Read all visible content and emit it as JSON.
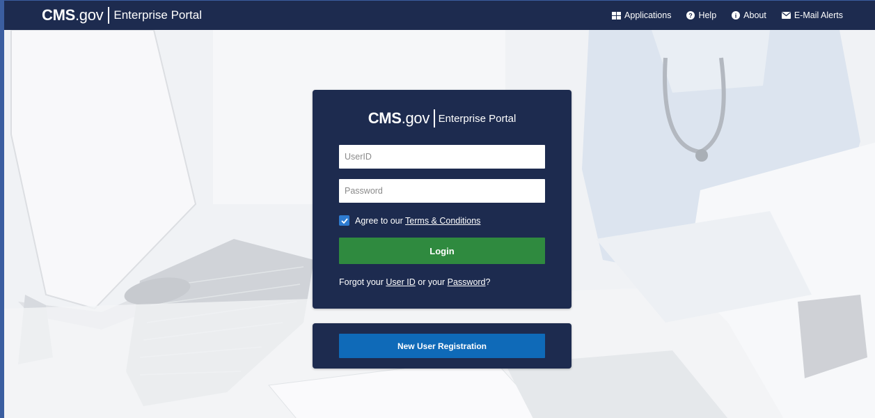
{
  "header": {
    "brand_bold": "CMS",
    "brand_domain": ".gov",
    "brand_portal": "Enterprise Portal",
    "nav": [
      {
        "label": "Applications",
        "icon": "grid-icon"
      },
      {
        "label": "Help",
        "icon": "question-circle-icon"
      },
      {
        "label": "About",
        "icon": "info-circle-icon"
      },
      {
        "label": "E-Mail Alerts",
        "icon": "envelope-icon"
      }
    ]
  },
  "login": {
    "brand_bold": "CMS",
    "brand_domain": ".gov",
    "brand_portal": "Enterprise Portal",
    "userid_placeholder": "UserID",
    "password_placeholder": "Password",
    "agree_prefix": "Agree to our ",
    "agree_link": "Terms & Conditions",
    "agree_checked": true,
    "login_label": "Login",
    "forgot_prefix": "Forgot your ",
    "forgot_userid": "User ID",
    "forgot_middle": " or your ",
    "forgot_password": "Password",
    "forgot_suffix": "?"
  },
  "registration": {
    "button_label": "New User Registration"
  },
  "colors": {
    "navy": "#1d2b4f",
    "login_green": "#2f8a3f",
    "register_blue": "#0f6ab8",
    "checkbox_blue": "#2e7bd0"
  }
}
